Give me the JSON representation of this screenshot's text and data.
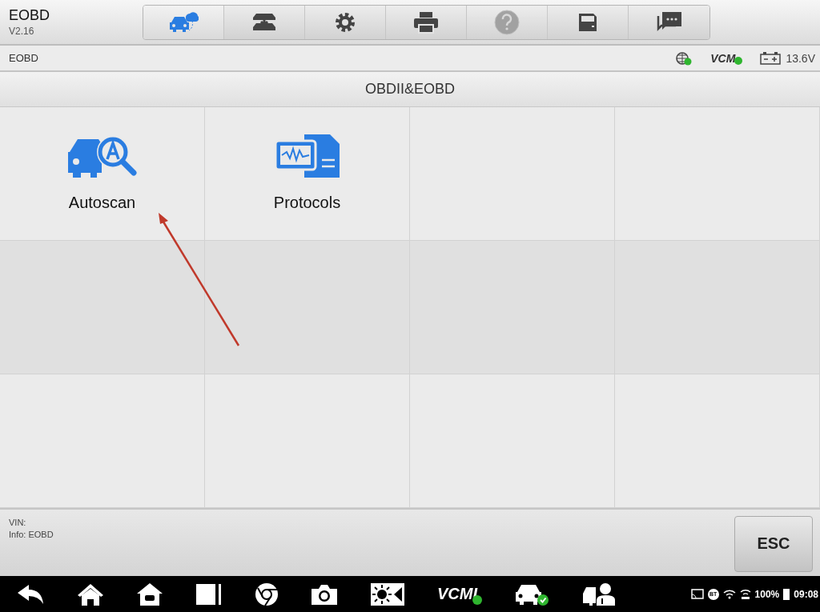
{
  "app": {
    "title": "EOBD",
    "version": "V2.16"
  },
  "toolbar": [
    {
      "kind": "remote",
      "selected": true,
      "disabled": false
    },
    {
      "kind": "lift",
      "selected": false,
      "disabled": false
    },
    {
      "kind": "settings",
      "selected": false,
      "disabled": false
    },
    {
      "kind": "print",
      "selected": false,
      "disabled": false
    },
    {
      "kind": "help",
      "selected": false,
      "disabled": true
    },
    {
      "kind": "save",
      "selected": false,
      "disabled": false
    },
    {
      "kind": "feedback",
      "selected": false,
      "disabled": false
    }
  ],
  "breadcrumb": "EOBD",
  "status": {
    "vcm_label": "VCM",
    "voltage": "13.6V"
  },
  "page_title": "OBDII&EOBD",
  "functions": [
    {
      "kind": "autoscan",
      "label": "Autoscan"
    },
    {
      "kind": "protocols",
      "label": "Protocols"
    }
  ],
  "footer": {
    "vin": "VIN:",
    "info": "Info: EOBD",
    "esc": "ESC"
  },
  "taskbar": [
    {
      "kind": "back"
    },
    {
      "kind": "home"
    },
    {
      "kind": "android-home"
    },
    {
      "kind": "recents"
    },
    {
      "kind": "browser"
    },
    {
      "kind": "camera"
    },
    {
      "kind": "brightness"
    },
    {
      "kind": "vcmi",
      "label": "VCMI"
    },
    {
      "kind": "car-check"
    },
    {
      "kind": "technician"
    }
  ],
  "system": {
    "bt": "BT",
    "battery": "100%",
    "time": "09:08"
  }
}
